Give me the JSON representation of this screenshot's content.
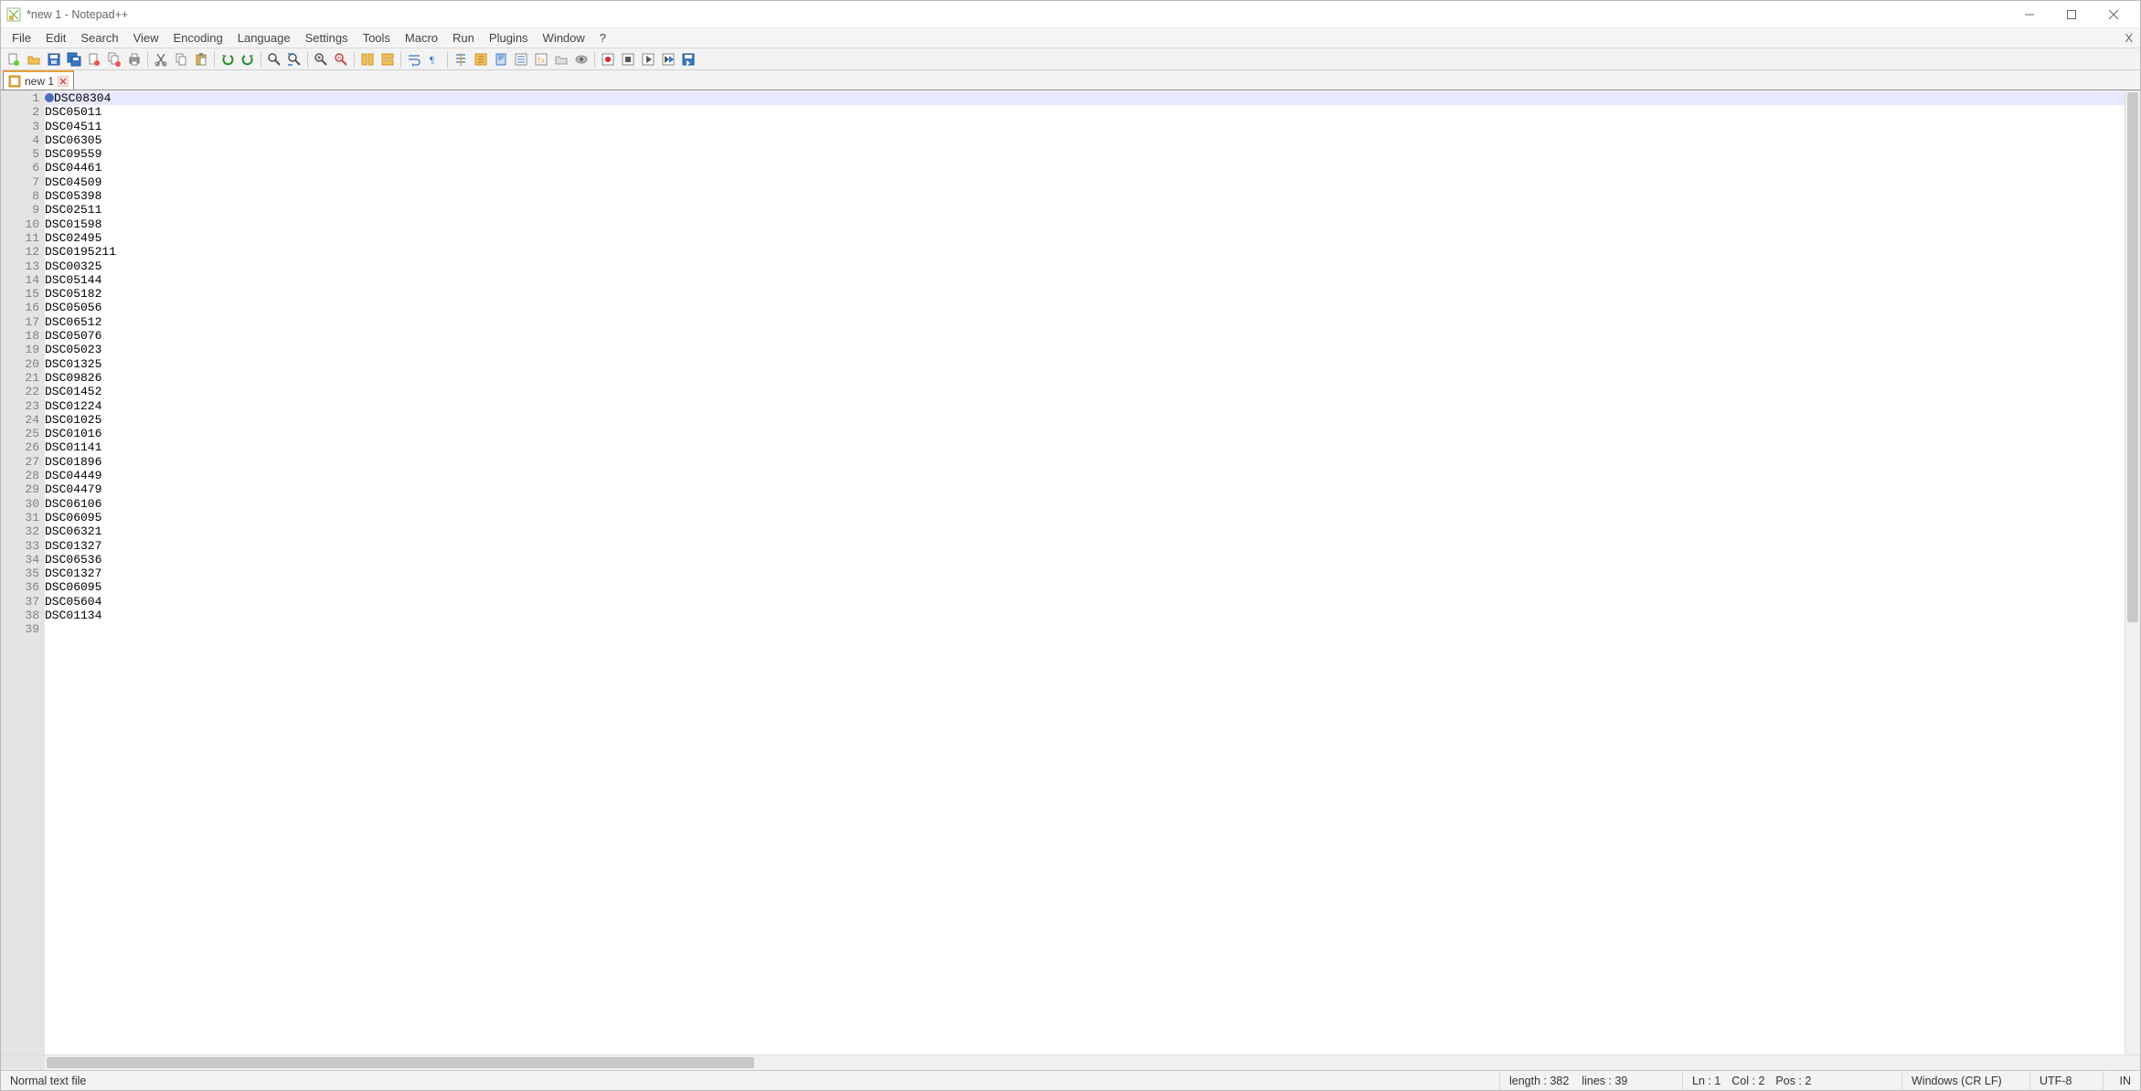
{
  "window": {
    "title": "*new 1 - Notepad++"
  },
  "menu": {
    "items": [
      "File",
      "Edit",
      "Search",
      "View",
      "Encoding",
      "Language",
      "Settings",
      "Tools",
      "Macro",
      "Run",
      "Plugins",
      "Window",
      "?"
    ],
    "mdi_close": "X"
  },
  "toolbar_icons": [
    "new-file-icon",
    "open-icon",
    "save-icon",
    "save-all-icon",
    "close-icon",
    "close-all-icon",
    "print-icon",
    "sep",
    "cut-icon",
    "copy-icon",
    "paste-icon",
    "sep",
    "undo-icon",
    "redo-icon",
    "sep",
    "find-icon",
    "replace-icon",
    "sep",
    "zoom-in-icon",
    "zoom-out-icon",
    "sep",
    "sync-v-icon",
    "sync-h-icon",
    "sep",
    "wrap-icon",
    "show-all-icon",
    "sep",
    "indent-guide-icon",
    "user-lang-icon",
    "doc-map-icon",
    "doc-list-icon",
    "func-list-icon",
    "folder-icon",
    "monitoring-icon",
    "sep",
    "record-icon",
    "stop-icon",
    "play-icon",
    "play-multi-icon",
    "save-macro-icon"
  ],
  "tabs": [
    {
      "label": "new 1",
      "modified": true
    }
  ],
  "editor": {
    "lines": [
      "DSC08304",
      "DSC05011",
      "DSC04511",
      "DSC06305",
      "DSC09559",
      "DSC04461",
      "DSC04509",
      "DSC05398",
      "DSC02511",
      "DSC01598",
      "DSC02495",
      "DSC0195211",
      "DSC00325",
      "DSC05144",
      "DSC05182",
      "DSC05056",
      "DSC06512",
      "DSC05076",
      "DSC05023",
      "DSC01325",
      "DSC09826",
      "DSC01452",
      "DSC01224",
      "DSC01025",
      "DSC01016",
      "DSC01141",
      "DSC01896",
      "DSC04449",
      "DSC04479",
      "DSC06106",
      "DSC06095",
      "DSC06321",
      "DSC01327",
      "DSC06536",
      "DSC01327",
      "DSC06095",
      "DSC05604",
      "DSC01134",
      ""
    ],
    "active_line": 1
  },
  "status": {
    "lang": "Normal text file",
    "length_label": "length : 382",
    "lines_label": "lines : 39",
    "ln": "Ln : 1",
    "col": "Col : 2",
    "pos": "Pos : 2",
    "eol": "Windows (CR LF)",
    "encoding": "UTF-8",
    "ins": "IN"
  }
}
